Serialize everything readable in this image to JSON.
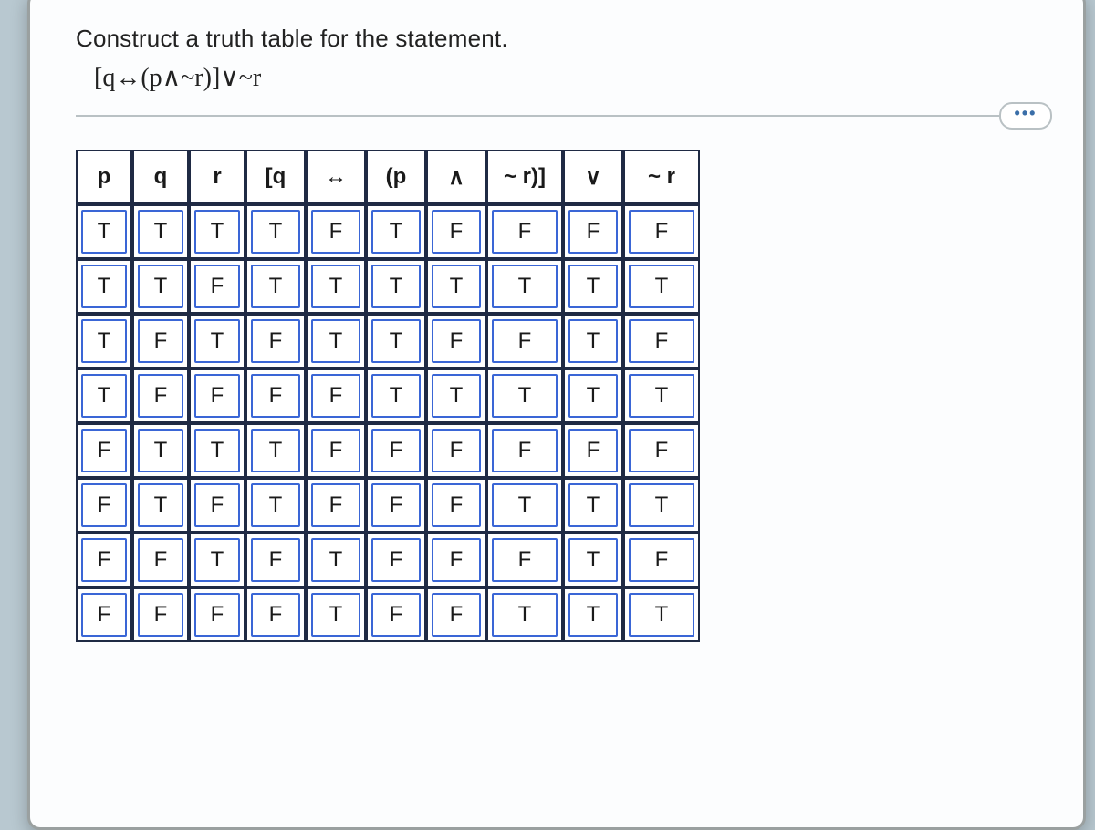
{
  "prompt": "Construct a truth table for the statement.",
  "statement": "[q↔(p∧~r)]∨~r",
  "more_icon": "•••",
  "headers": [
    "p",
    "q",
    "r",
    "[q",
    "↔",
    "(p",
    "∧",
    "~ r)]",
    "∨",
    "~ r"
  ],
  "rows": [
    [
      "T",
      "T",
      "T",
      "T",
      "F",
      "T",
      "F",
      "F",
      "F",
      "F"
    ],
    [
      "T",
      "T",
      "F",
      "T",
      "T",
      "T",
      "T",
      "T",
      "T",
      "T"
    ],
    [
      "T",
      "F",
      "T",
      "F",
      "T",
      "T",
      "F",
      "F",
      "T",
      "F"
    ],
    [
      "T",
      "F",
      "F",
      "F",
      "F",
      "T",
      "T",
      "T",
      "T",
      "T"
    ],
    [
      "F",
      "T",
      "T",
      "T",
      "F",
      "F",
      "F",
      "F",
      "F",
      "F"
    ],
    [
      "F",
      "T",
      "F",
      "T",
      "F",
      "F",
      "F",
      "T",
      "T",
      "T"
    ],
    [
      "F",
      "F",
      "T",
      "F",
      "T",
      "F",
      "F",
      "F",
      "T",
      "F"
    ],
    [
      "F",
      "F",
      "F",
      "F",
      "T",
      "F",
      "F",
      "T",
      "T",
      "T"
    ]
  ]
}
